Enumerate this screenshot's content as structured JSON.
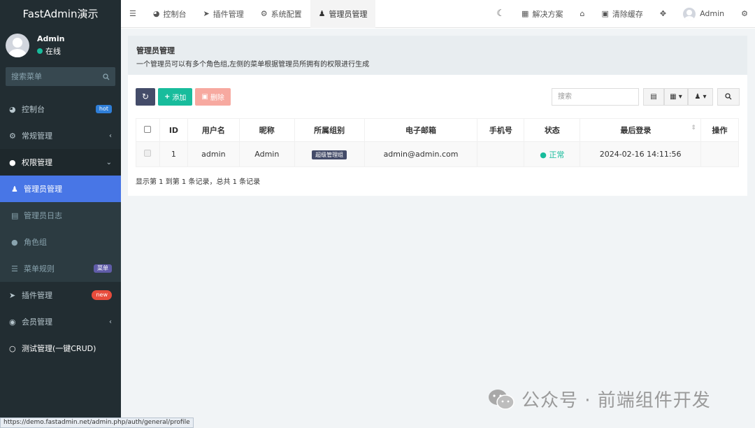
{
  "brand": "FastAdmin演示",
  "user": {
    "name": "Admin",
    "status": "在线"
  },
  "sidebar_search": {
    "placeholder": "搜索菜单"
  },
  "menu": {
    "dashboard": {
      "label": "控制台",
      "badge": "hot"
    },
    "general": {
      "label": "常规管理"
    },
    "auth": {
      "label": "权限管理"
    },
    "admin": {
      "label": "管理员管理"
    },
    "adminlog": {
      "label": "管理员日志"
    },
    "group": {
      "label": "角色组"
    },
    "rule": {
      "label": "菜单规则",
      "badge": "菜单"
    },
    "addon": {
      "label": "插件管理",
      "badge": "new"
    },
    "member": {
      "label": "会员管理"
    },
    "test": {
      "label": "测试管理(一键CRUD)"
    }
  },
  "topbar": {
    "tabs": {
      "dashboard": "控制台",
      "addon": "插件管理",
      "config": "系统配置",
      "admin": "管理员管理"
    },
    "solutions": "解决方案",
    "clear_cache": "清除缓存",
    "user": "Admin"
  },
  "panel": {
    "title": "管理员管理",
    "desc": "一个管理员可以有多个角色组,左侧的菜单根据管理员所拥有的权限进行生成"
  },
  "toolbar": {
    "add": "添加",
    "delete": "删除",
    "search_placeholder": "搜索"
  },
  "table": {
    "headers": {
      "id": "ID",
      "username": "用户名",
      "nickname": "昵称",
      "group": "所属组别",
      "email": "电子邮箱",
      "mobile": "手机号",
      "status": "状态",
      "logintime": "最后登录",
      "operate": "操作"
    },
    "rows": [
      {
        "id": "1",
        "username": "admin",
        "nickname": "Admin",
        "group": "超级管理组",
        "email": "admin@admin.com",
        "mobile": "",
        "status": "正常",
        "logintime": "2024-02-16 14:11:56"
      }
    ]
  },
  "pagination_text": "显示第 1 到第 1 条记录，总共 1 条记录",
  "watermark": "公众号 · 前端组件开发",
  "status_url": "https://demo.fastadmin.net/admin.php/auth/general/profile",
  "colors": {
    "sidebar": "#222d32",
    "active": "#4876e6",
    "accent": "#18bc9c",
    "danger": "#e74c3c"
  }
}
